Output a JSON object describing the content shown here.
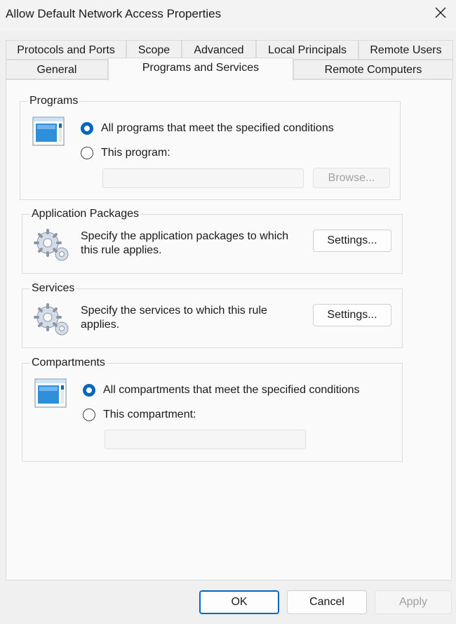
{
  "window": {
    "title": "Allow Default Network Access Properties"
  },
  "tabs": {
    "row1": [
      "Protocols and Ports",
      "Scope",
      "Advanced",
      "Local Principals",
      "Remote Users"
    ],
    "row2": [
      "General",
      "Programs and Services",
      "Remote Computers"
    ],
    "active": "Programs and Services"
  },
  "programs": {
    "label": "Programs",
    "option_all": "All programs that meet the specified conditions",
    "option_this": "This program:",
    "selected": "all",
    "path_value": "",
    "browse_label": "Browse..."
  },
  "packages": {
    "label": "Application Packages",
    "description": "Specify the application packages to which this rule applies.",
    "settings_label": "Settings..."
  },
  "services": {
    "label": "Services",
    "description": "Specify the services to which this rule applies.",
    "settings_label": "Settings..."
  },
  "compartments": {
    "label": "Compartments",
    "option_all": "All compartments that meet the specified conditions",
    "option_this": "This compartment:",
    "selected": "all",
    "value": ""
  },
  "footer": {
    "ok": "OK",
    "cancel": "Cancel",
    "apply": "Apply"
  },
  "colors": {
    "accent": "#0067c0",
    "background": "#f0f0f0",
    "panel": "#fafafa"
  },
  "icons": [
    "close-icon",
    "program-window-icon",
    "gears-icon"
  ]
}
